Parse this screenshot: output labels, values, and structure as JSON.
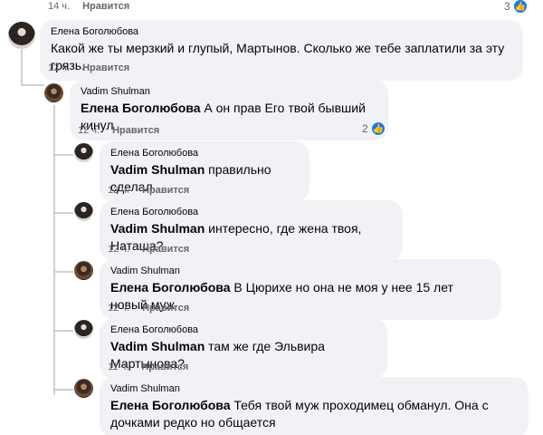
{
  "top": {
    "time": "14 ч.",
    "like_label": "Нравится",
    "reaction_count": "3"
  },
  "comments": [
    {
      "author": "Елена Боголюбова",
      "mention": "",
      "text": "Какой же ты мерзкий и глупый, Мартынов. Сколько же тебе заплатили за эту грязь.",
      "time": "12 ч.",
      "like_label": "Нравится"
    },
    {
      "author": "Vadim Shulman",
      "mention": "Елена Боголюбова",
      "text": "А он прав Его твой бывший кинул",
      "time": "12 ч.",
      "like_label": "Нравится",
      "reaction_count": "2"
    },
    {
      "author": "Елена Боголюбова",
      "mention": "Vadim Shulman",
      "text": "правильно сделал.",
      "time": "12 ч.",
      "like_label": "Нравится"
    },
    {
      "author": "Елена Боголюбова",
      "mention": "Vadim Shulman",
      "text": "интересно, где жена твоя, Наташа?",
      "time": "12 ч.",
      "like_label": "Нравится"
    },
    {
      "author": "Vadim Shulman",
      "mention": "Елена Боголюбова",
      "text": "В Цюрихе но она не моя у нее 15 лет новый муж",
      "time": "12 ч.",
      "like_label": "Нравится"
    },
    {
      "author": "Елена Боголюбова",
      "mention": "Vadim Shulman",
      "text": "там же где Эльвира Мартынова?",
      "time": "11 ч.",
      "like_label": "Нравится"
    },
    {
      "author": "Vadim Shulman",
      "mention": "Елена Боголюбова",
      "text": "Тебя твой муж проходимец обманул. Она с дочками редко но общается",
      "time": "",
      "like_label": ""
    }
  ],
  "colors": {
    "bubble_bg": "#f0f2f5",
    "meta_text": "#65676b",
    "like_blue": "#1877f2",
    "thread_line": "#ced0d4"
  },
  "icons": {
    "reaction": "thumbs-up-icon"
  }
}
